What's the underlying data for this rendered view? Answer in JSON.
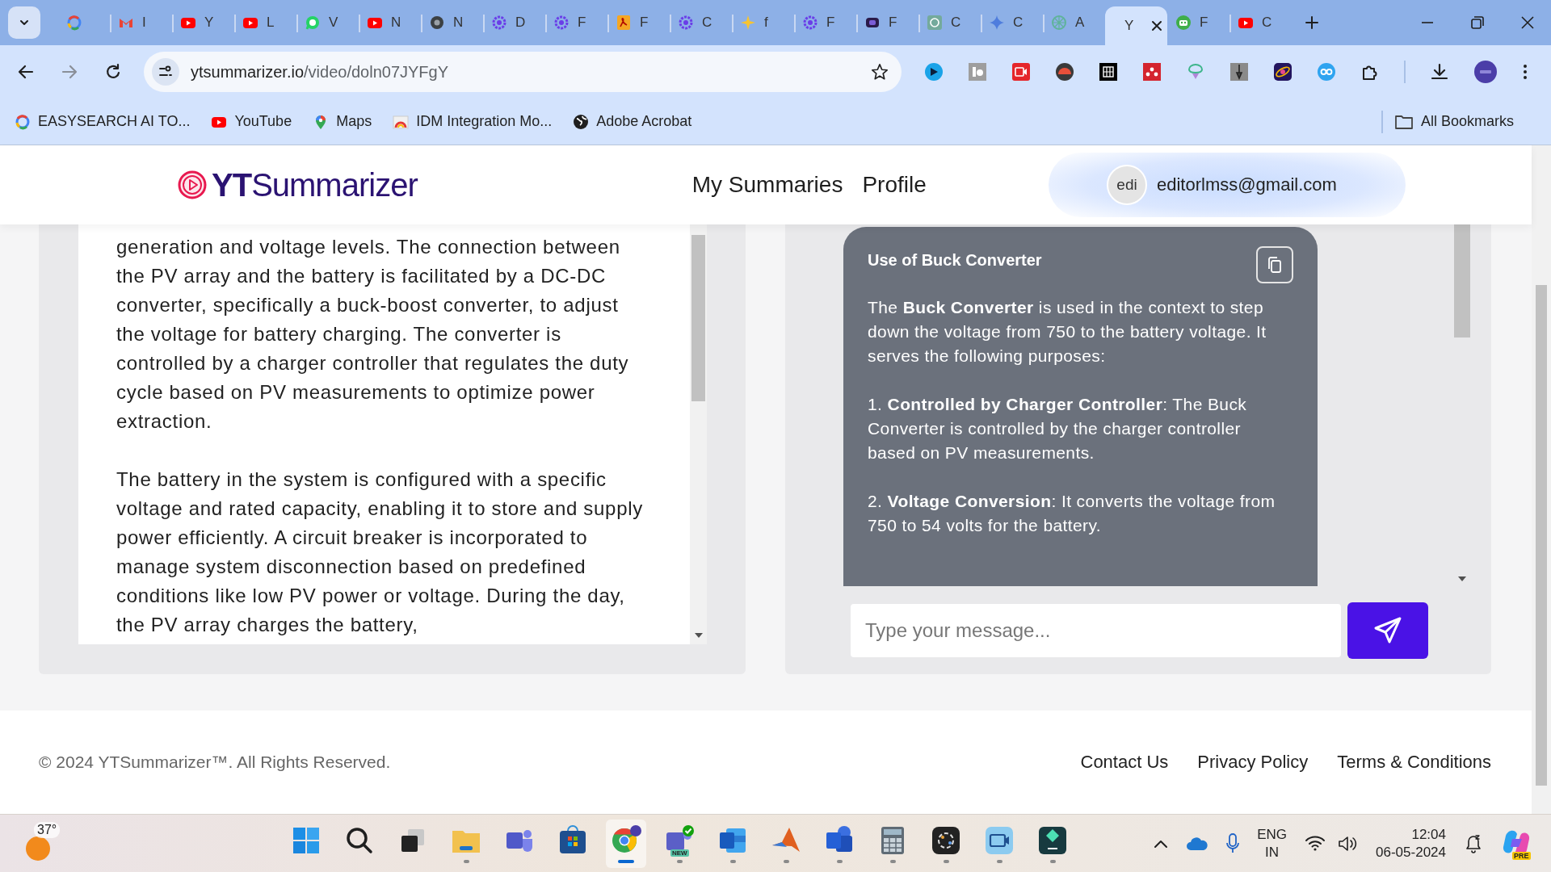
{
  "browser": {
    "tabs": [
      {
        "selected": false
      },
      {
        "title": "I",
        "selected": false
      },
      {
        "title": "Y",
        "selected": false
      },
      {
        "title": "L",
        "selected": false
      },
      {
        "title": "V",
        "selected": false
      },
      {
        "title": "N",
        "selected": false
      },
      {
        "title": "N",
        "selected": false
      },
      {
        "title": "D",
        "selected": false
      },
      {
        "title": "F",
        "selected": false
      },
      {
        "title": "F",
        "selected": false
      },
      {
        "title": "C",
        "selected": false
      },
      {
        "title": "f",
        "selected": false
      },
      {
        "title": "F",
        "selected": false
      },
      {
        "title": "F",
        "selected": false
      },
      {
        "title": "C",
        "selected": false
      },
      {
        "title": "C",
        "selected": false
      },
      {
        "title": "A",
        "selected": false
      },
      {
        "title": "Y",
        "selected": true
      },
      {
        "title": "F",
        "selected": false
      },
      {
        "title": "C",
        "selected": false
      }
    ],
    "address": {
      "host": "ytsummarizer.io",
      "path": "/video/doln07JYFgY"
    },
    "bookmarks": [
      "EASYSEARCH AI TO...",
      "YouTube",
      "Maps",
      "IDM Integration Mo...",
      "Adobe Acrobat"
    ],
    "all_bookmarks": "All Bookmarks"
  },
  "page": {
    "logo": "**YT**Summarizer",
    "nav": [
      "My Summaries",
      "Profile"
    ],
    "user": {
      "avatar": "edi",
      "email": "editorlmss@gmail.com"
    },
    "summary": {
      "paragraphs": [
        "generation and voltage levels. The connection between the PV array and the battery is facilitated by a DC-DC converter, specifically a buck-boost converter, to adjust the voltage for battery charging. The converter is controlled by a charger controller that regulates the duty cycle based on PV measurements to optimize power extraction.",
        "The battery in the system is configured with a specific voltage and rated capacity, enabling it to store and supply power efficiently. A circuit breaker is incorporated to manage system disconnection based on predefined conditions like low PV power or voltage. During the day, the PV array charges the battery,"
      ]
    },
    "chat": {
      "message": {
        "title": "Use of Buck Converter",
        "paragraphs": [
          "The **Buck Converter** is used in the context to step down the voltage from 750 to the battery voltage. It serves the following purposes:",
          "1. **Controlled by Charger Controller**: The Buck Converter is controlled by the charger controller based on PV measurements.",
          "2. **Voltage Conversion**: It converts the voltage from 750 to 54 volts for the battery."
        ]
      },
      "input": {
        "placeholder": "Type your message..."
      }
    },
    "footer": {
      "copyright": "© 2024 YTSummarizer™. All Rights Reserved.",
      "links": [
        "Contact Us",
        "Privacy Policy",
        "Terms & Conditions"
      ]
    }
  },
  "taskbar": {
    "weather": "37°",
    "apps": [
      {
        "selected": false,
        "running": false
      },
      {
        "selected": false,
        "running": false
      },
      {
        "selected": false,
        "running": false
      },
      {
        "selected": false,
        "running": true
      },
      {
        "selected": false,
        "running": false
      },
      {
        "selected": false,
        "running": false
      },
      {
        "selected": true,
        "running": true
      },
      {
        "selected": false,
        "running": true,
        "badge": "NEW"
      },
      {
        "selected": false,
        "running": true
      },
      {
        "selected": false,
        "running": true
      },
      {
        "selected": false,
        "running": true
      },
      {
        "selected": false,
        "running": true
      },
      {
        "selected": false,
        "running": true
      },
      {
        "selected": false,
        "running": true
      },
      {
        "selected": false,
        "running": true
      }
    ],
    "language": [
      "ENG",
      "IN"
    ],
    "time": "12:04",
    "date": "06-05-2024",
    "copilot_badge": "PRE"
  }
}
